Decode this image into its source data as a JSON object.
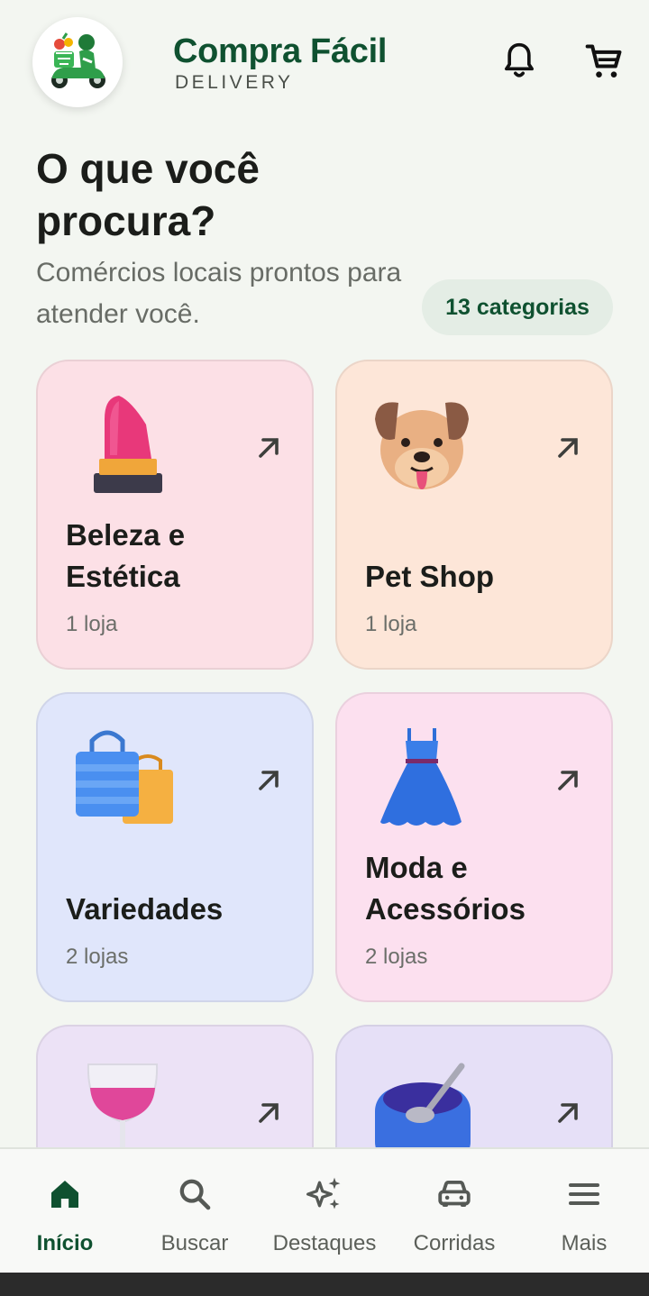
{
  "header": {
    "title": "Compra Fácil",
    "subtitle": "DELIVERY",
    "icons": [
      "logo-delivery-scooter",
      "bell-icon",
      "cart-icon"
    ]
  },
  "intro": {
    "headline": "O que você procura?",
    "subline": "Comércios locais prontos para atender você.",
    "count_badge": "13 categorias"
  },
  "categories": [
    {
      "name": "Beleza e Estética",
      "stores": "1 loja",
      "icon": "lipstick-icon",
      "color": "#fce0e6"
    },
    {
      "name": "Pet Shop",
      "stores": "1 loja",
      "icon": "dog-face-icon",
      "color": "#fde6d8"
    },
    {
      "name": "Variedades",
      "stores": "2 lojas",
      "icon": "shopping-bags-icon",
      "color": "#e0e6fb"
    },
    {
      "name": "Moda e Acessórios",
      "stores": "2 lojas",
      "icon": "dress-icon",
      "color": "#fce0ef"
    },
    {
      "name": "",
      "stores": "",
      "icon": "wine-glass-icon",
      "color": "#ece2f6"
    },
    {
      "name": "",
      "stores": "",
      "icon": "bowl-spoon-icon",
      "color": "#e6e0f7"
    }
  ],
  "bottom_nav": [
    {
      "label": "Início",
      "icon": "home-icon",
      "active": true
    },
    {
      "label": "Buscar",
      "icon": "search-icon",
      "active": false
    },
    {
      "label": "Destaques",
      "icon": "sparkles-icon",
      "active": false
    },
    {
      "label": "Corridas",
      "icon": "car-icon",
      "active": false
    },
    {
      "label": "Mais",
      "icon": "menu-icon",
      "active": false
    }
  ],
  "colors": {
    "brand_green": "#0f5130",
    "background": "#f3f6f1",
    "pill_bg": "#e4ede5"
  }
}
